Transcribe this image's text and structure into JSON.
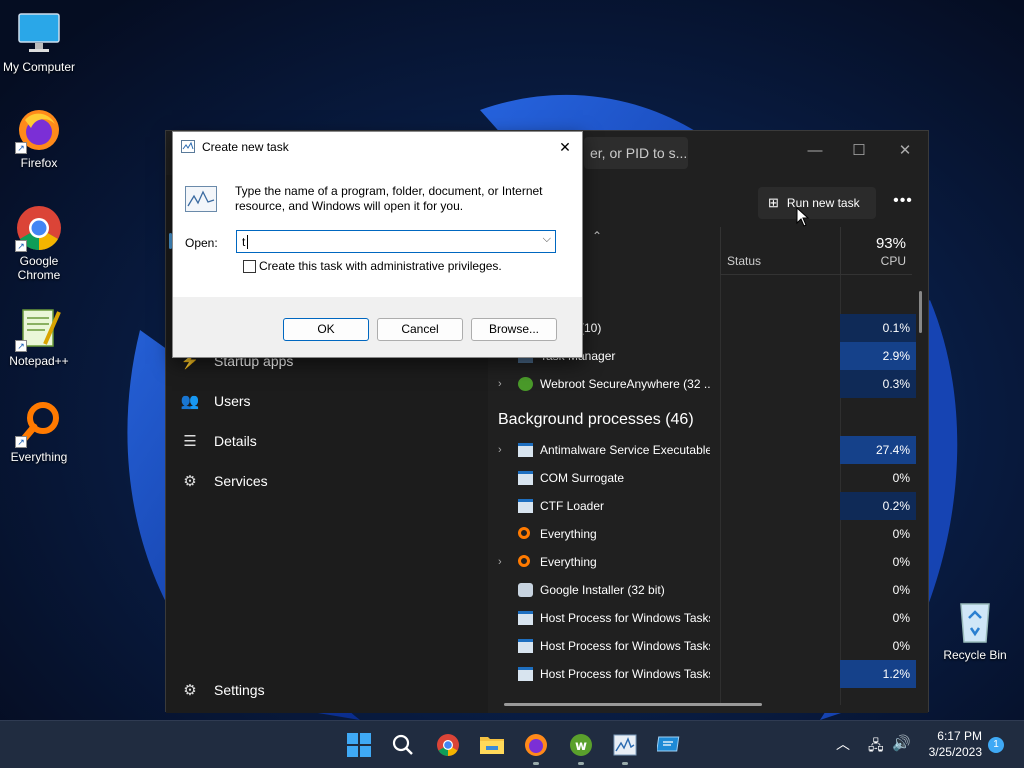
{
  "desktop": {
    "icons": [
      {
        "label": "My Computer"
      },
      {
        "label": "Firefox"
      },
      {
        "label": "Google Chrome"
      },
      {
        "label": "Notepad++"
      },
      {
        "label": "Everything"
      },
      {
        "label": "Recycle Bin"
      }
    ]
  },
  "task_manager": {
    "search_placeholder": "er, or PID to s...",
    "window_controls": {
      "minimize": "—",
      "maximize": "☐",
      "close": "✕"
    },
    "nav": [
      {
        "label": "Startup apps",
        "icon": "startup-icon"
      },
      {
        "label": "Users",
        "icon": "users-icon"
      },
      {
        "label": "Details",
        "icon": "details-icon"
      },
      {
        "label": "Services",
        "icon": "services-icon"
      }
    ],
    "settings_label": "Settings",
    "toolbar": {
      "run_new_task": "Run new task",
      "more": "•••"
    },
    "columns": {
      "status": "Status",
      "cpu_percent": "93%",
      "cpu": "CPU"
    },
    "apps_rows": [
      {
        "name": "(10)",
        "cpu": "0.1%"
      },
      {
        "name": "Task Manager",
        "cpu": "2.9%"
      },
      {
        "name": "Webroot SecureAnywhere (32 ...",
        "cpu": "0.3%"
      }
    ],
    "background_header": "Background processes (46)",
    "background_rows": [
      {
        "name": "Antimalware Service Executable",
        "cpu": "27.4%",
        "expand": true
      },
      {
        "name": "COM Surrogate",
        "cpu": "0%",
        "expand": false
      },
      {
        "name": "CTF Loader",
        "cpu": "0.2%",
        "expand": false
      },
      {
        "name": "Everything",
        "cpu": "0%",
        "expand": false
      },
      {
        "name": "Everything",
        "cpu": "0%",
        "expand": true
      },
      {
        "name": "Google Installer (32 bit)",
        "cpu": "0%",
        "expand": false
      },
      {
        "name": "Host Process for Windows Tasks",
        "cpu": "0%",
        "expand": false
      },
      {
        "name": "Host Process for Windows Tasks",
        "cpu": "0%",
        "expand": false
      },
      {
        "name": "Host Process for Windows Tasks",
        "cpu": "1.2%",
        "expand": false
      }
    ]
  },
  "dialog": {
    "title": "Create new task",
    "close": "✕",
    "description": "Type the name of a program, folder, document, or Internet resource, and Windows will open it for you.",
    "open_label": "Open:",
    "open_value": "t",
    "admin_checkbox_label": "Create this task with administrative privileges.",
    "admin_checked": false,
    "ok": "OK",
    "cancel": "Cancel",
    "browse": "Browse..."
  },
  "taskbar": {
    "time": "6:17 PM",
    "date": "3/25/2023",
    "notification_count": "1"
  }
}
